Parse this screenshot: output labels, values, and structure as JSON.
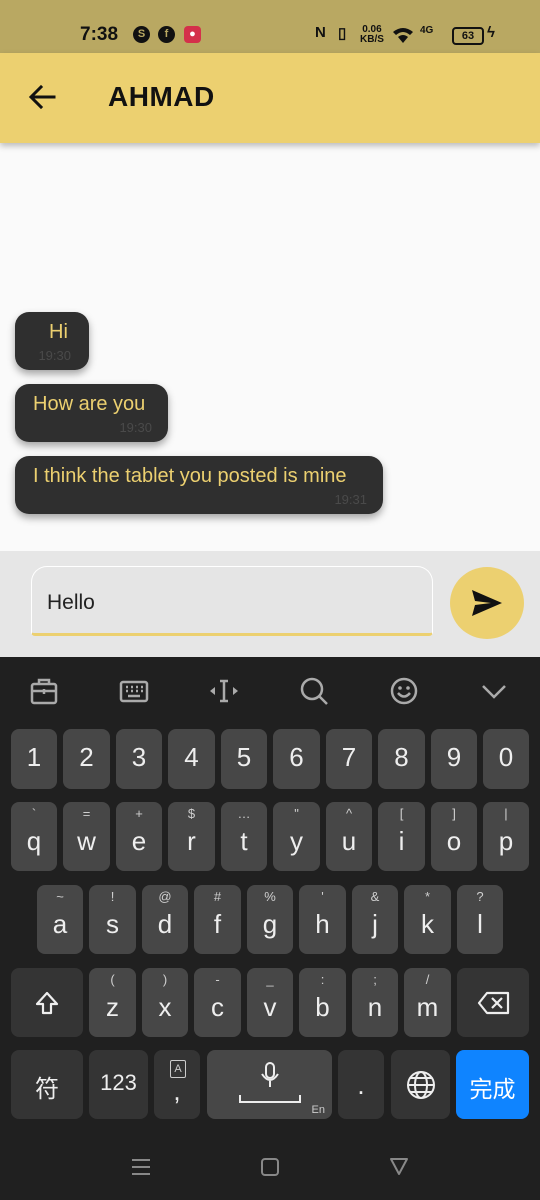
{
  "status_bar": {
    "time": "7:38",
    "net_speed_top": "0.06",
    "net_speed_bottom": "KB/S",
    "net_type": "4G",
    "battery": "63"
  },
  "app_bar": {
    "title": "AHMAD"
  },
  "messages": [
    {
      "text": "Hi",
      "time": "19:30"
    },
    {
      "text": "How are you",
      "time": "19:30"
    },
    {
      "text": "I think the tablet you posted is mine",
      "time": "19:31"
    }
  ],
  "composer": {
    "value": "Hello"
  },
  "keyboard": {
    "numbers": [
      "1",
      "2",
      "3",
      "4",
      "5",
      "6",
      "7",
      "8",
      "9",
      "0"
    ],
    "row1": [
      {
        "k": "q",
        "s": "`"
      },
      {
        "k": "w",
        "s": "="
      },
      {
        "k": "e",
        "s": "+"
      },
      {
        "k": "r",
        "s": "$"
      },
      {
        "k": "t",
        "s": "…"
      },
      {
        "k": "y",
        "s": "\""
      },
      {
        "k": "u",
        "s": "^"
      },
      {
        "k": "i",
        "s": "["
      },
      {
        "k": "o",
        "s": "]"
      },
      {
        "k": "p",
        "s": "|"
      }
    ],
    "row2": [
      {
        "k": "a",
        "s": "~"
      },
      {
        "k": "s",
        "s": "!"
      },
      {
        "k": "d",
        "s": "@"
      },
      {
        "k": "f",
        "s": "#"
      },
      {
        "k": "g",
        "s": "%"
      },
      {
        "k": "h",
        "s": "'"
      },
      {
        "k": "j",
        "s": "&"
      },
      {
        "k": "k",
        "s": "*"
      },
      {
        "k": "l",
        "s": "?"
      }
    ],
    "row3": [
      {
        "k": "z",
        "s": "("
      },
      {
        "k": "x",
        "s": ")"
      },
      {
        "k": "c",
        "s": "-"
      },
      {
        "k": "v",
        "s": "_"
      },
      {
        "k": "b",
        "s": ":"
      },
      {
        "k": "n",
        "s": ";"
      },
      {
        "k": "m",
        "s": "/"
      }
    ],
    "symbols_label": "符",
    "num_label": "123",
    "comma_label": ",",
    "period_label": ".",
    "space_lang": "En",
    "done_label": "完成"
  },
  "colors": {
    "accent": "#ecd070",
    "bubble": "#2f2f2f",
    "done": "#0f84ff"
  }
}
